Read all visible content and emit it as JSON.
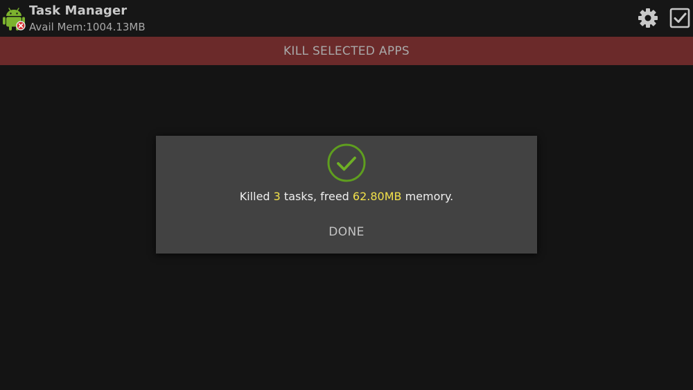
{
  "app": {
    "title": "Task Manager",
    "avail_mem_label": "Avail Mem:",
    "avail_mem_value": "1004.13MB"
  },
  "toolbar": {
    "settings_icon": "gear-icon",
    "select_all_icon": "checkbox-checked-icon"
  },
  "kill_bar": {
    "label": "KILL SELECTED APPS"
  },
  "dialog": {
    "icon": "check-circle-icon",
    "message_prefix": "Killed ",
    "tasks_count": "3",
    "message_middle": " tasks, freed ",
    "freed_memory": "62.80MB",
    "message_suffix": " memory.",
    "done_label": "DONE"
  },
  "colors": {
    "kill_bar": "#6b2a2a",
    "dialog_bg": "#424242",
    "highlight": "#f2e14a",
    "check_green": "#5f9e1f",
    "android_green": "#7cb32e",
    "badge_red": "#d32f2f"
  }
}
